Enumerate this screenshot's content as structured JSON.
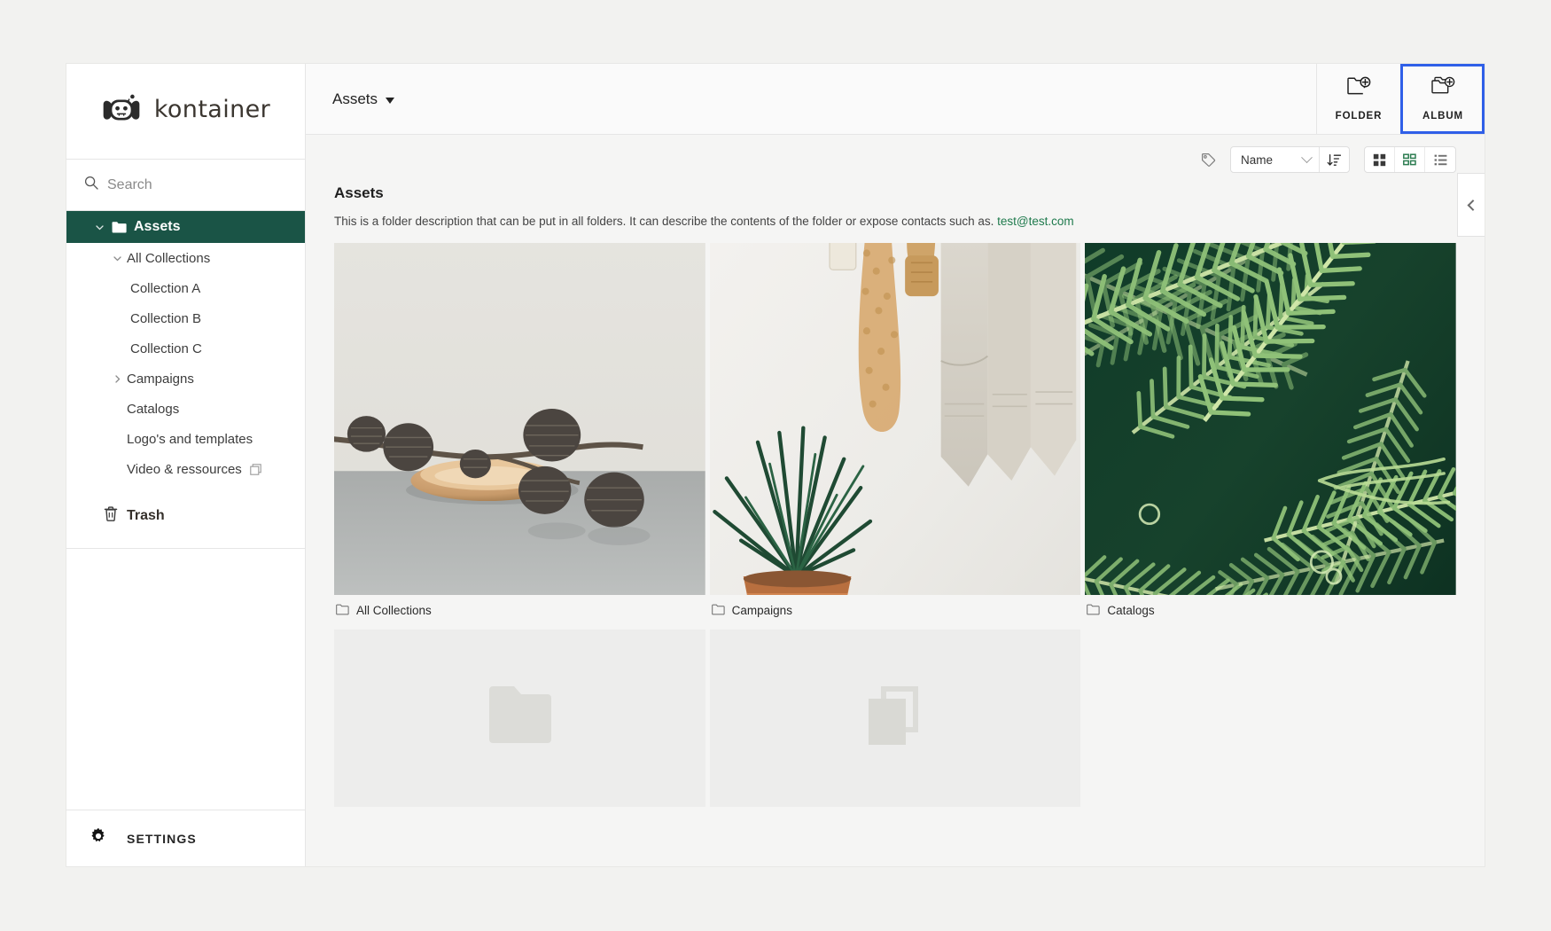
{
  "brand": {
    "name": "kontainer",
    "logo_icon": "robot-mascot-icon"
  },
  "sidebar": {
    "search": {
      "placeholder": "Search",
      "value": "",
      "icon": "search-icon"
    },
    "items": [
      {
        "label": "Assets",
        "level": 0,
        "active": true,
        "caret": "down",
        "icon": "folder-filled-icon"
      },
      {
        "label": "All Collections",
        "level": 1,
        "active": false,
        "caret": "down",
        "icon": ""
      },
      {
        "label": "Collection A",
        "level": 2,
        "active": false,
        "caret": "",
        "icon": ""
      },
      {
        "label": "Collection B",
        "level": 2,
        "active": false,
        "caret": "",
        "icon": ""
      },
      {
        "label": "Collection C",
        "level": 2,
        "active": false,
        "caret": "",
        "icon": ""
      },
      {
        "label": "Campaigns",
        "level": 1,
        "active": false,
        "caret": "right",
        "icon": ""
      },
      {
        "label": "Catalogs",
        "level": 1,
        "active": false,
        "caret": "",
        "icon": ""
      },
      {
        "label": "Logo's and templates",
        "level": 1,
        "active": false,
        "caret": "",
        "icon": ""
      },
      {
        "label": "Video & ressources",
        "level": 1,
        "active": false,
        "caret": "",
        "icon": "copy-stack-icon"
      }
    ],
    "trash": {
      "label": "Trash",
      "icon": "trash-icon"
    },
    "settings": {
      "label": "SETTINGS",
      "icon": "gear-icon"
    }
  },
  "topbar": {
    "breadcrumb": "Assets",
    "breadcrumb_caret_icon": "caret-down-icon",
    "actions": [
      {
        "label": "FOLDER",
        "icon": "folder-plus-icon",
        "focused": false
      },
      {
        "label": "ALBUM",
        "icon": "album-plus-icon",
        "focused": true
      }
    ],
    "focus_ring_color": "#2f5fe8"
  },
  "toolbar": {
    "tag_icon": "tag-icon",
    "sort": {
      "value": "Name",
      "chevron_icon": "chevron-down-icon",
      "direction_icon": "sort-descending-icon"
    },
    "views": [
      {
        "icon": "grid-large-icon",
        "active": false
      },
      {
        "icon": "grid-detail-icon",
        "active": true,
        "color": "#2e7d52"
      },
      {
        "icon": "list-view-icon",
        "active": false
      }
    ]
  },
  "content": {
    "title": "Assets",
    "description_prefix": "This is a folder description that can be put in all folders. It can describe the contents of the folder or expose contacts such as. ",
    "description_link": "test@test.com",
    "link_color": "#1f7a4d",
    "items": [
      {
        "label": "All Collections",
        "icon": "folder-outline-icon",
        "image": "pinecones-on-wooden-dish"
      },
      {
        "label": "Campaigns",
        "icon": "folder-outline-icon",
        "image": "towels-on-rack-with-plant"
      },
      {
        "label": "Catalogs",
        "icon": "folder-outline-icon",
        "image": "green-fern-leaves"
      }
    ],
    "placeholders": [
      {
        "icon": "folder-placeholder-icon"
      },
      {
        "icon": "stacked-pages-placeholder-icon"
      }
    ]
  },
  "panel": {
    "collapse_icon": "chevron-left-icon"
  },
  "colors": {
    "sidebar_active": "#1a5446",
    "accent_green": "#2e7d52",
    "page_bg": "#f5f5f4"
  }
}
